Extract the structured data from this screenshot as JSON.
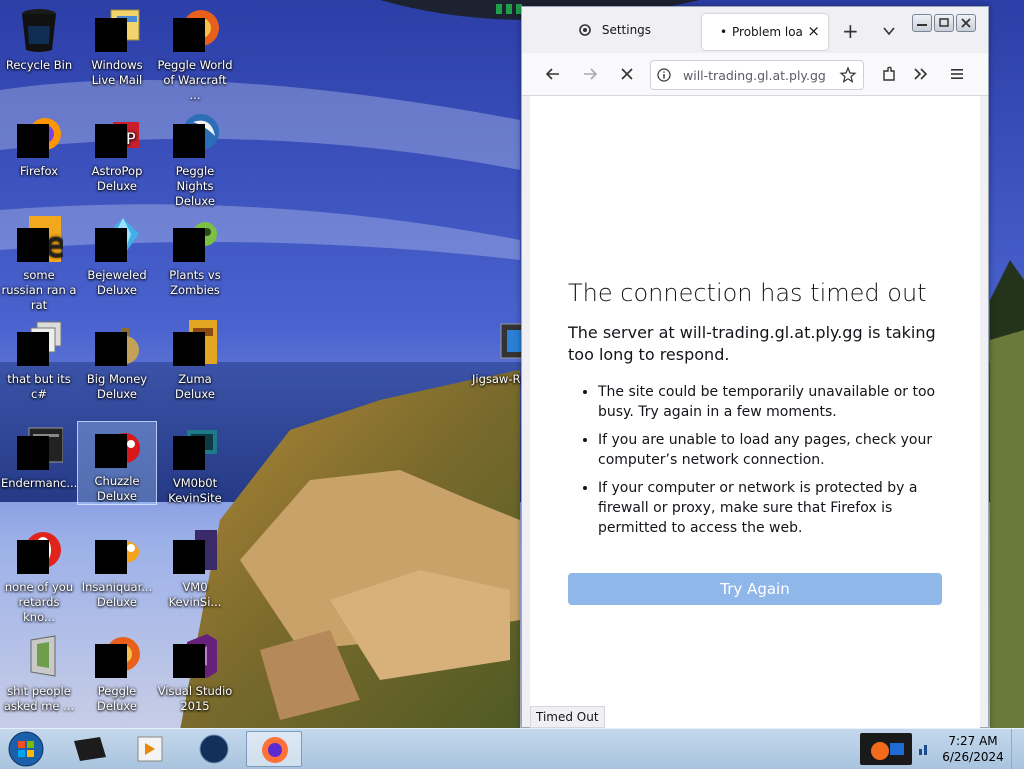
{
  "desktop": {
    "icons": [
      {
        "label": "Recycle Bin"
      },
      {
        "label": "Windows Live Mail"
      },
      {
        "label": "Peggle World of Warcraft ..."
      },
      {
        "label": "Firefox"
      },
      {
        "label": "AstroPop Deluxe"
      },
      {
        "label": "Peggle Nights Deluxe"
      },
      {
        "label": "some russian ran a rat"
      },
      {
        "label": "Bejeweled Deluxe"
      },
      {
        "label": "Plants vs Zombies"
      },
      {
        "label": "that but its c#"
      },
      {
        "label": "Big Money Deluxe"
      },
      {
        "label": "Zuma Deluxe"
      },
      {
        "label": "Endermanc..."
      },
      {
        "label": "Chuzzle Deluxe"
      },
      {
        "label": "VM0b0t KevinSite"
      },
      {
        "label": "none of you retards kno..."
      },
      {
        "label": "Insaniquar... Deluxe"
      },
      {
        "label": "VM0 KevinSi..."
      },
      {
        "label": "shit people asked me ..."
      },
      {
        "label": "Peggle Deluxe"
      },
      {
        "label": "Visual Studio 2015"
      },
      {
        "label": "Jigsaw-Ra"
      }
    ]
  },
  "browser": {
    "tabs": {
      "settings_label": "Settings",
      "active_title": "Problem loading page",
      "active_dot": "•",
      "close_glyph": "×",
      "new_tab_glyph": "+"
    },
    "url": "will-trading.gl.at.ply.gg",
    "error": {
      "title": "The connection has timed out",
      "lead": "The server at will-trading.gl.at.ply.gg is taking too long to respond.",
      "bullets": [
        "The site could be temporarily unavailable or too busy. Try again in a few moments.",
        "If you are unable to load any pages, check your computer’s network connection.",
        "If your computer or network is protected by a firewall or proxy, make sure that Firefox is permitted to access the web."
      ],
      "button": "Try Again"
    },
    "status": "Timed Out"
  },
  "taskbar": {
    "time": "7:27 AM",
    "date": "6/26/2024"
  }
}
